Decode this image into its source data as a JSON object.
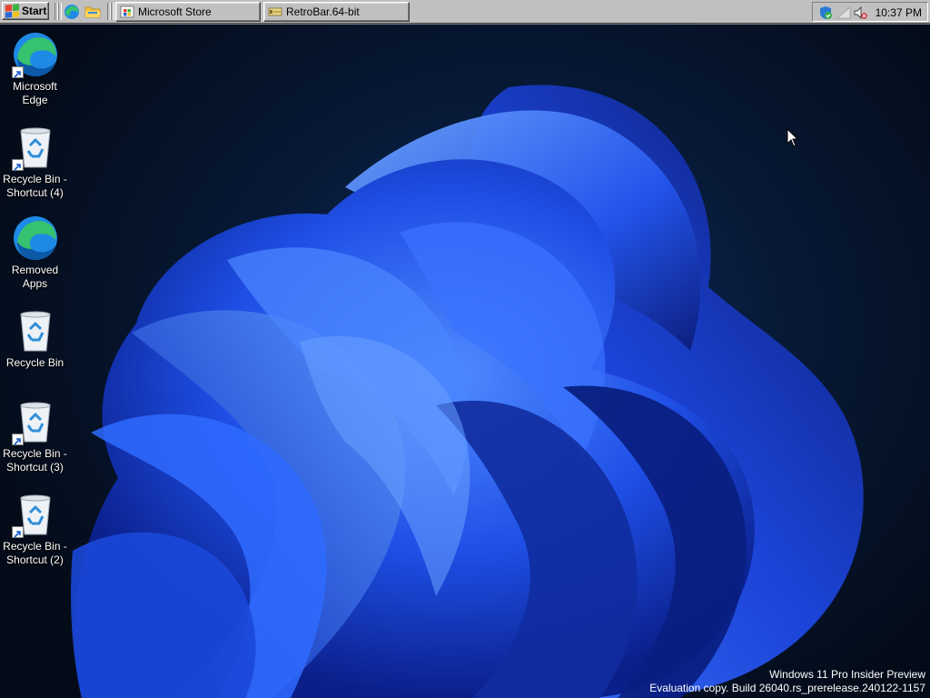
{
  "taskbar": {
    "start_label": "Start",
    "tasks": [
      {
        "label": "Microsoft Store",
        "icon": "store-icon"
      },
      {
        "label": "RetroBar.64-bit",
        "icon": "retrobar-icon"
      }
    ],
    "quick_launch": [
      "edge-icon",
      "folder-icon"
    ],
    "tray": {
      "icons": [
        "defender-shield-icon",
        "network-icon",
        "speaker-muted-icon"
      ],
      "clock": "10:37 PM"
    }
  },
  "desktop": {
    "icons": [
      {
        "label": "Microsoft Edge",
        "icon": "edge-icon",
        "shortcut": true
      },
      {
        "label": "Recycle Bin - Shortcut (4)",
        "icon": "recycle-bin-icon",
        "shortcut": true
      },
      {
        "label": "Removed Apps",
        "icon": "edge-icon",
        "shortcut": false
      },
      {
        "label": "Recycle Bin",
        "icon": "recycle-bin-icon",
        "shortcut": false
      },
      {
        "label": "Recycle Bin - Shortcut (3)",
        "icon": "recycle-bin-icon",
        "shortcut": true
      },
      {
        "label": "Recycle Bin - Shortcut (2)",
        "icon": "recycle-bin-icon",
        "shortcut": true
      }
    ]
  },
  "watermark": {
    "line1": "Windows 11 Pro Insider Preview",
    "line2": "Evaluation copy. Build 26040.rs_prerelease.240122-1157"
  },
  "colors": {
    "taskbar": "#c0c0c0",
    "wallpaper_dark": "#040b18",
    "bloom_blue": "#1a4fe0"
  }
}
